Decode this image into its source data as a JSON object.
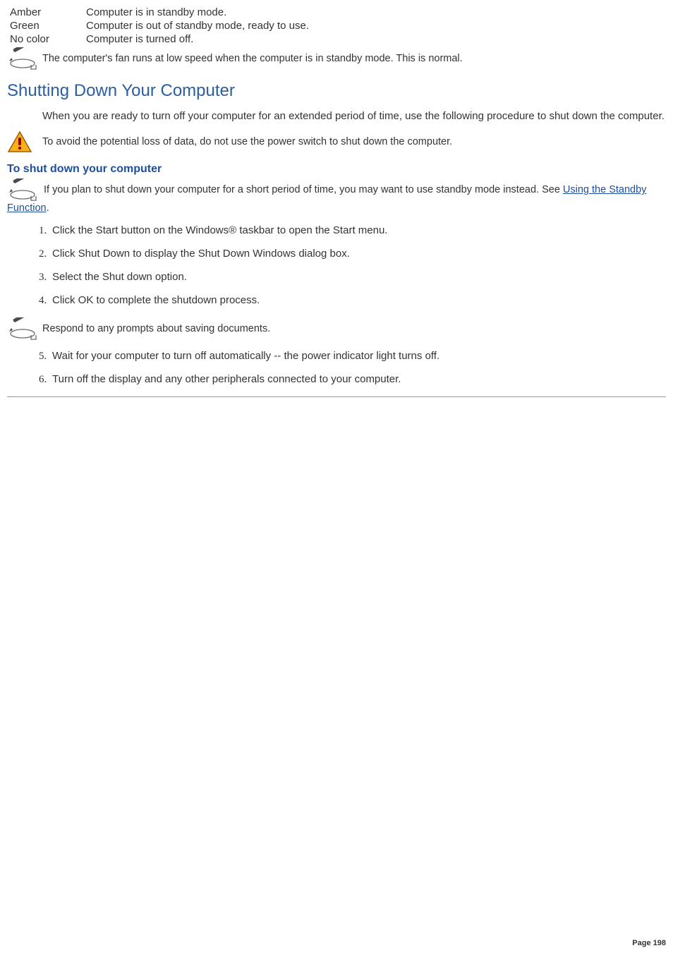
{
  "led_table": {
    "rows": [
      {
        "label": "Amber",
        "desc": "Computer is in standby mode."
      },
      {
        "label": "Green",
        "desc": "Computer is out of standby mode, ready to use."
      },
      {
        "label": "No color",
        "desc": "Computer is turned off."
      }
    ]
  },
  "note_fan": "The computer's fan runs at low speed when the computer is in standby mode. This is normal.",
  "heading_shutdown": "Shutting Down Your Computer",
  "para_shutdown_intro": "When you are ready to turn off your computer for an extended period of time, use the following procedure to shut down the computer.",
  "warn_shutdown": "To avoid the potential loss of data, do not use the power switch to shut down the computer.",
  "subheading_procedure": "To shut down your computer",
  "note_standby_prefix": "If you plan to shut down your computer for a short period of time, you may want to use standby mode instead. See ",
  "link_standby_text": "Using the Standby Function",
  "note_standby_suffix": ".",
  "steps_a": [
    "Click the Start button on the Windows® taskbar to open the Start menu.",
    "Click Shut Down to display the Shut Down Windows dialog box.",
    "Select the Shut down option.",
    "Click OK to complete the shutdown process."
  ],
  "note_respond": "Respond to any prompts about saving documents.",
  "steps_b": [
    "Wait for your computer to turn off automatically -- the power indicator light turns off.",
    "Turn off the display and any other peripherals connected to your computer."
  ],
  "page_number": "Page 198"
}
